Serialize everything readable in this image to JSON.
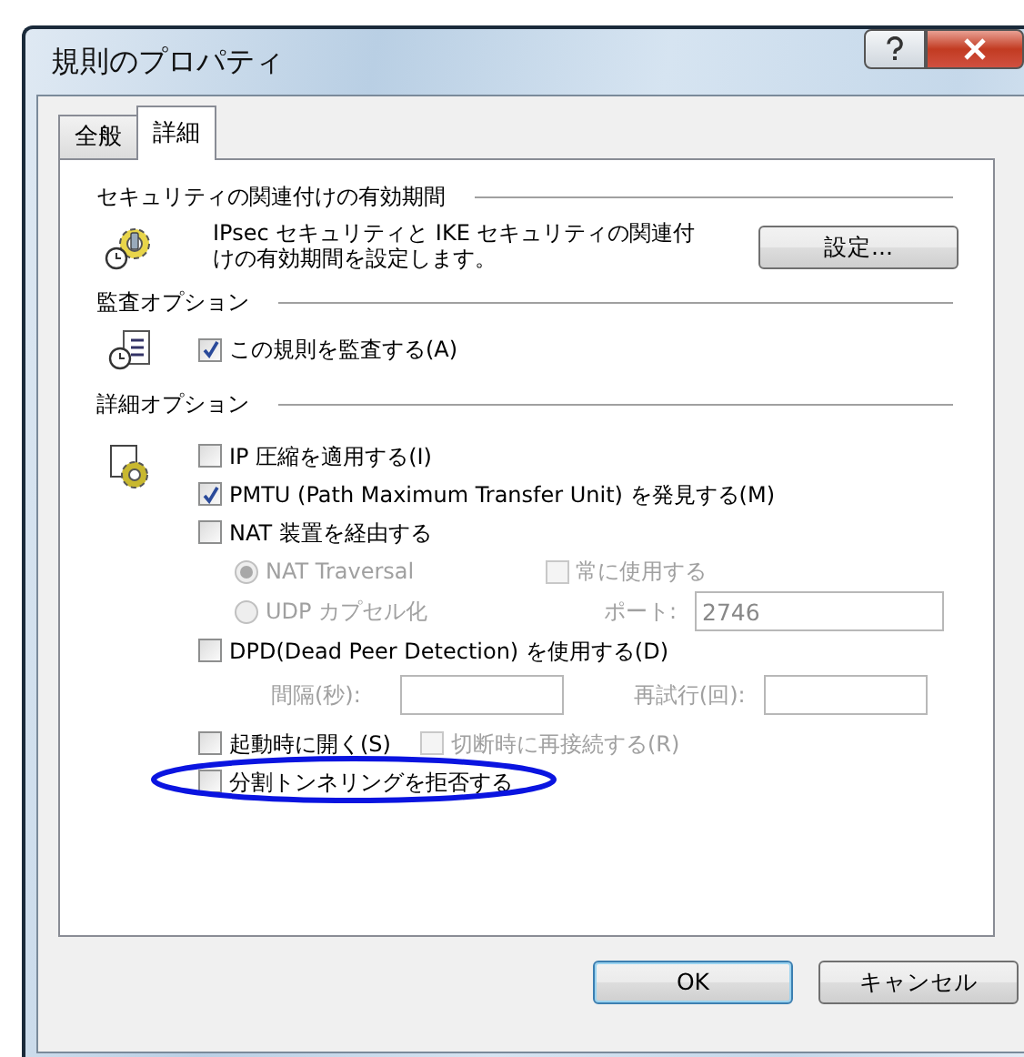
{
  "window": {
    "title": "規則のプロパティ"
  },
  "tabs": [
    {
      "label": "全般",
      "selected": false
    },
    {
      "label": "詳細",
      "selected": true
    }
  ],
  "lifetime": {
    "heading": "セキュリティの関連付けの有効期間",
    "description": "IPsec セキュリティと IKE セキュリティの関連付けの有効期間を設定します。",
    "button": "設定..."
  },
  "audit": {
    "heading": "監査オプション",
    "checkbox": {
      "label": "この規則を監査する(A)",
      "checked": true
    }
  },
  "advanced": {
    "heading": "詳細オプション",
    "rows": [
      {
        "indented": false,
        "controls": [
          {
            "kind": "checkbox",
            "label": "IP 圧縮を適用する(I)",
            "checked": false,
            "disabled": false
          }
        ]
      },
      {
        "indented": false,
        "controls": [
          {
            "kind": "checkbox",
            "label": "PMTU (Path Maximum Transfer Unit) を発見する(M)",
            "checked": true,
            "disabled": false
          }
        ]
      },
      {
        "indented": false,
        "controls": [
          {
            "kind": "checkbox",
            "label": "NAT 装置を経由する",
            "checked": false,
            "disabled": false
          }
        ]
      },
      {
        "indented": true,
        "controls": [
          {
            "kind": "radio",
            "label": "NAT Traversal",
            "selected": true,
            "disabled": true
          },
          {
            "kind": "checkbox",
            "label": "常に使用する",
            "checked": false,
            "disabled": true
          }
        ]
      },
      {
        "indented": true,
        "controls": [
          {
            "kind": "radio",
            "label": "UDP カプセル化",
            "selected": false,
            "disabled": true
          },
          {
            "kind": "field",
            "label": "ポート:",
            "value": "2746",
            "disabled": true
          }
        ]
      },
      {
        "indented": false,
        "controls": [
          {
            "kind": "checkbox",
            "label": "DPD(Dead Peer Detection) を使用する(D)",
            "checked": false,
            "disabled": false
          }
        ]
      },
      {
        "indented": true,
        "controls": [
          {
            "kind": "field",
            "label": "間隔(秒):",
            "disabled": true
          },
          {
            "kind": "field",
            "label": "再試行(回):",
            "disabled": true
          }
        ]
      },
      {
        "indented": false,
        "controls": [
          {
            "kind": "checkbox",
            "label": "起動時に開く(S)",
            "checked": false,
            "disabled": false
          },
          {
            "kind": "checkbox",
            "label": "切断時に再接続する(R)",
            "checked": false,
            "disabled": true
          }
        ]
      },
      {
        "indented": false,
        "controls": [
          {
            "kind": "checkbox",
            "label": "分割トンネリングを拒否する",
            "checked": false,
            "disabled": false,
            "circled": true
          }
        ]
      }
    ]
  },
  "buttons": [
    {
      "label": "OK",
      "default": true
    },
    {
      "label": "キャンセル",
      "default": false
    }
  ]
}
